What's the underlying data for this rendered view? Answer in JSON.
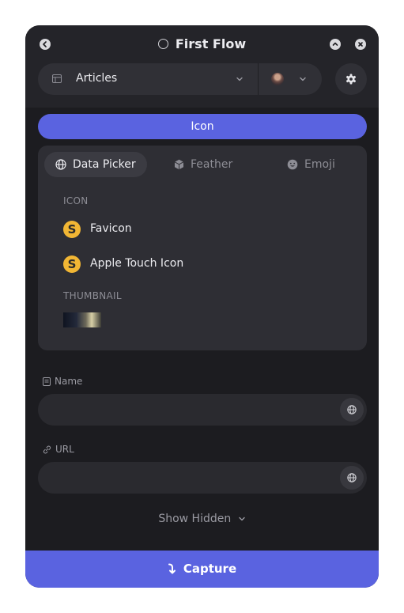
{
  "header": {
    "title": "First Flow",
    "collection_label": "Articles"
  },
  "tab": {
    "label": "Icon"
  },
  "picker": {
    "tabs": [
      {
        "label": "Data Picker",
        "active": true
      },
      {
        "label": "Feather",
        "active": false
      },
      {
        "label": "Emoji",
        "active": false
      }
    ],
    "icon_section": "ICON",
    "items": [
      {
        "badge": "S",
        "label": "Favicon"
      },
      {
        "badge": "S",
        "label": "Apple Touch Icon"
      }
    ],
    "thumbnail_section": "THUMBNAIL"
  },
  "fields": {
    "name_label": "Name",
    "name_value": "",
    "url_label": "URL",
    "url_value": ""
  },
  "show_hidden": "Show Hidden",
  "capture": "Capture",
  "colors": {
    "accent": "#5a63e0",
    "panel": "#1c1c20",
    "badge": "#f1b634"
  }
}
